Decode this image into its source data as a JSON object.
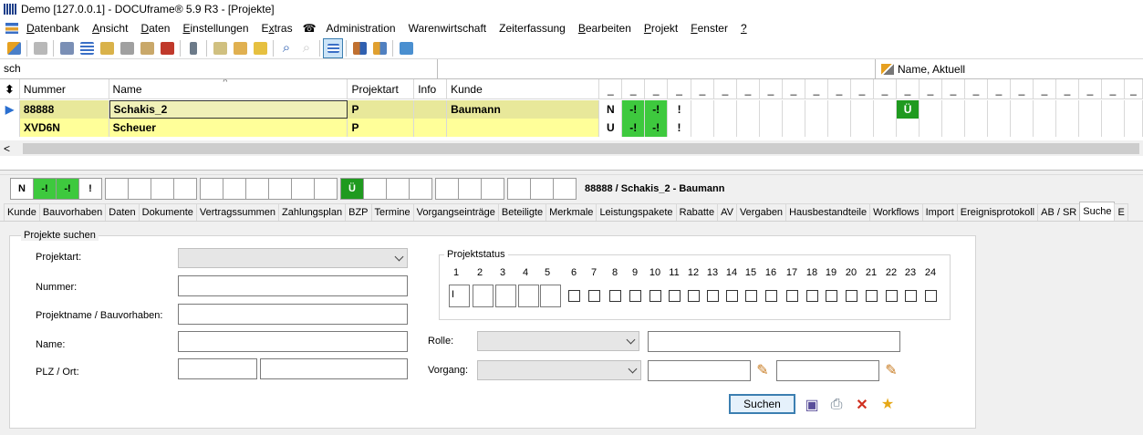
{
  "window": {
    "title": "Demo [127.0.0.1] - DOCUframe® 5.9 R3 - [Projekte]"
  },
  "menu": [
    "Datenbank",
    "Ansicht",
    "Daten",
    "Einstellungen",
    "Extras",
    "Administration",
    "Warenwirtschaft",
    "Zeiterfassung",
    "Bearbeiten",
    "Projekt",
    "Fenster",
    "?"
  ],
  "menu_underline": [
    "D",
    "A",
    "D",
    "E",
    "x",
    "",
    "",
    "",
    "B",
    "P",
    "F",
    "?"
  ],
  "search": {
    "value": "sch",
    "filter_label": "Name, Aktuell"
  },
  "grid": {
    "headers": [
      "Nummer",
      "Name",
      "Projektart",
      "Info",
      "Kunde"
    ],
    "dash": "_",
    "rows": [
      {
        "nummer": "88888",
        "name": "Schakis_2",
        "projektart": "P",
        "info": "",
        "kunde": "Baumann",
        "status": "N",
        "s1": "-!",
        "s2": "-!",
        "s3": "!",
        "s_ue": "Ü"
      },
      {
        "nummer": "XVD6N",
        "name": "Scheuer",
        "projektart": "P",
        "info": "",
        "kunde": "",
        "status": "U",
        "s1": "-!",
        "s2": "-!",
        "s3": "!"
      }
    ],
    "scroll_left": "<"
  },
  "statusbar": {
    "boxes": [
      "N",
      "-!",
      "-!",
      "!",
      "",
      "",
      "",
      "",
      "",
      "",
      "",
      "",
      "",
      "",
      "Ü",
      "",
      "",
      "",
      "",
      "",
      "",
      "",
      "",
      ""
    ],
    "info": "88888 / Schakis_2 - Baumann"
  },
  "tabs": [
    "Kunde",
    "Bauvorhaben",
    "Daten",
    "Dokumente",
    "Vertragssummen",
    "Zahlungsplan",
    "BZP",
    "Termine",
    "Vorgangseinträge",
    "Beteiligte",
    "Merkmale",
    "Leistungspakete",
    "Rabatte",
    "AV",
    "Vergaben",
    "Hausbestandteile",
    "Workflows",
    "Import",
    "Ereignisprotokoll",
    "AB / SR",
    "Suche",
    "E"
  ],
  "form": {
    "legend": "Projekte suchen",
    "projektart_label": "Projektart:",
    "nummer_label": "Nummer:",
    "projektname_label": "Projektname / Bauvorhaben:",
    "name_label": "Name:",
    "plz_label": "PLZ / Ort:",
    "projektstatus_legend": "Projektstatus",
    "status_numbers": [
      "1",
      "2",
      "3",
      "4",
      "5",
      "6",
      "7",
      "8",
      "9",
      "10",
      "11",
      "12",
      "13",
      "14",
      "15",
      "16",
      "17",
      "18",
      "19",
      "20",
      "21",
      "22",
      "23",
      "24"
    ],
    "status_first_value": "I",
    "rolle_label": "Rolle:",
    "vorgang_label": "Vorgang:",
    "search_button": "Suchen"
  },
  "colors": {
    "green": "#3ec93e",
    "dark_green": "#1f9a1f",
    "row_selected": "#e8e89a",
    "row": "#ffff99",
    "accent": "#3c7fb1"
  }
}
